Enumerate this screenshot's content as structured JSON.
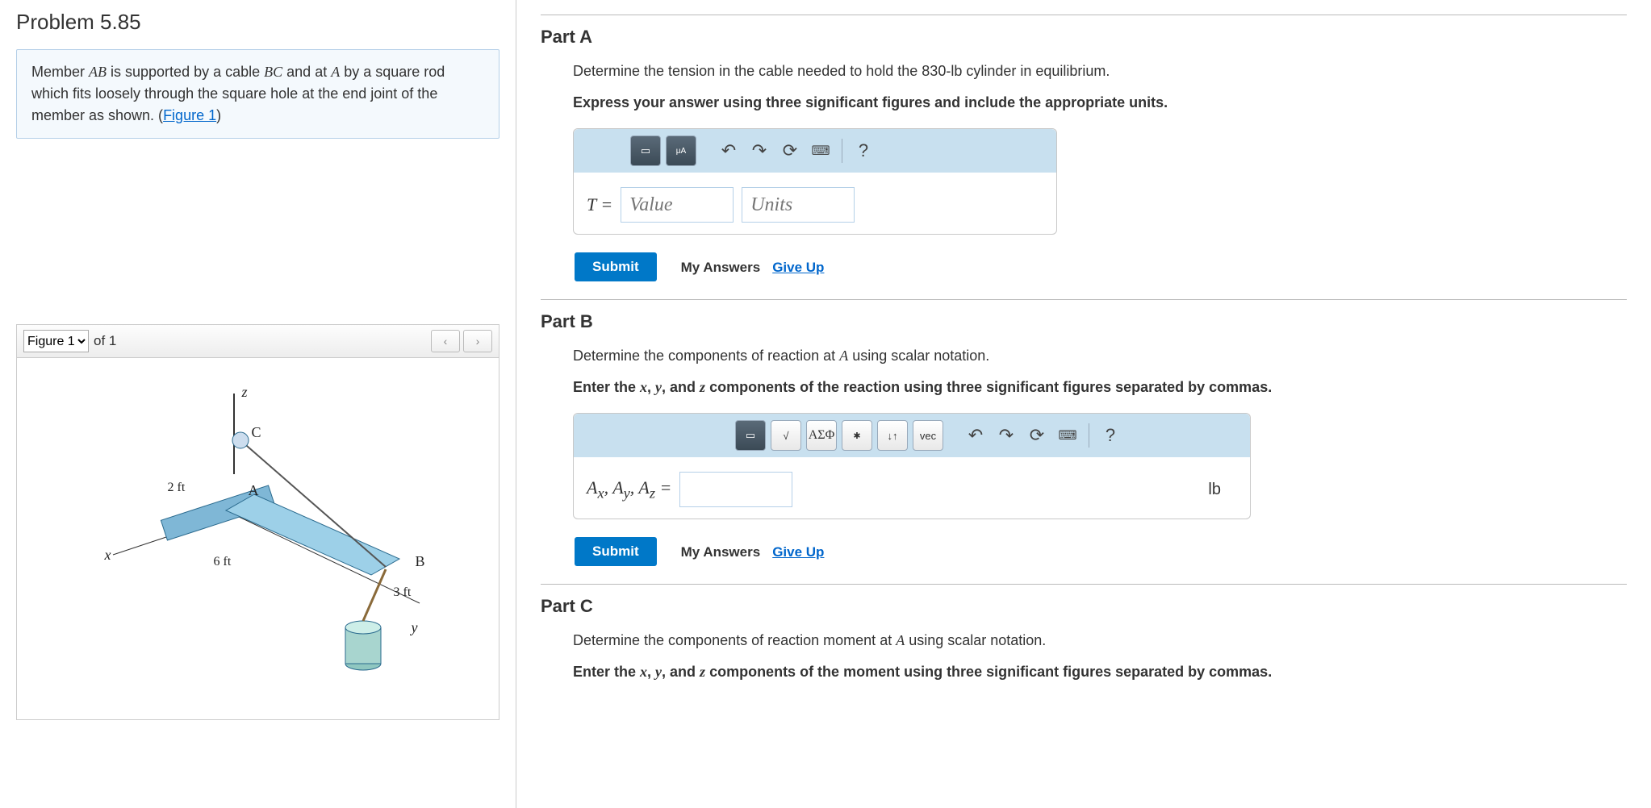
{
  "problem": {
    "title": "Problem 5.85",
    "desc_pre": "Member ",
    "desc_ab": "AB",
    "desc_mid1": " is supported by a cable ",
    "desc_bc": "BC",
    "desc_mid2": " and at ",
    "desc_a": "A",
    "desc_mid3": " by a square rod which fits loosely through the square hole at the end joint of the member as shown. (",
    "figure_link": "Figure 1",
    "desc_end": ")"
  },
  "figure": {
    "select_label": "Figure 1",
    "of_text": "of 1",
    "labels": {
      "z": "z",
      "C": "C",
      "A": "A",
      "x": "x",
      "B": "B",
      "y": "y",
      "d1": "2 ft",
      "d2": "6 ft",
      "d3": "3 ft"
    }
  },
  "partA": {
    "title": "Part A",
    "instr1_pre": "Determine the tension in the cable needed to hold the 830-",
    "instr1_unit": "lb",
    "instr1_post": " cylinder in equilibrium.",
    "instr2": "Express your answer using three significant figures and include the appropriate units.",
    "var": "T =",
    "placeholder_value": "Value",
    "placeholder_units": "Units",
    "submit": "Submit",
    "my_answers": "My Answers",
    "give_up": "Give Up",
    "help": "?"
  },
  "partB": {
    "title": "Part B",
    "instr1_pre": "Determine the components of reaction at ",
    "instr1_a": "A",
    "instr1_post": " using scalar notation.",
    "instr2_pre": "Enter the ",
    "instr2_x": "x",
    "instr2_c1": ", ",
    "instr2_y": "y",
    "instr2_c2": ", and ",
    "instr2_z": "z",
    "instr2_post": " components of the reaction using three significant figures separated by commas.",
    "var_a": "A",
    "var_sub_x": "x",
    "var_sub_y": "y",
    "var_sub_z": "z",
    "var_sep": ", ",
    "var_eq": " =",
    "unit": "lb",
    "submit": "Submit",
    "my_answers": "My Answers",
    "give_up": "Give Up",
    "help": "?",
    "greek": "ΑΣΦ",
    "vec": "vec"
  },
  "partC": {
    "title": "Part C",
    "instr1_pre": "Determine the components of reaction moment at ",
    "instr1_a": "A",
    "instr1_post": " using scalar notation.",
    "instr2_pre": "Enter the ",
    "instr2_x": "x",
    "instr2_c1": ", ",
    "instr2_y": "y",
    "instr2_c2": ", and ",
    "instr2_z": "z",
    "instr2_post": " components of the moment using three significant figures separated by commas."
  }
}
